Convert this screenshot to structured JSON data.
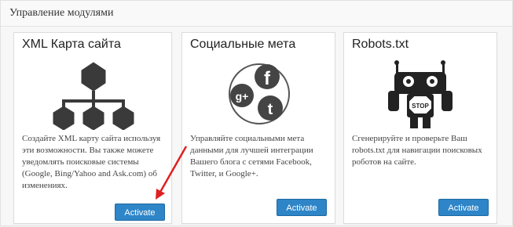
{
  "panel": {
    "title": "Управление модулями"
  },
  "modules": [
    {
      "title": "XML Карта сайта",
      "icon": "sitemap-tree-icon",
      "description": "Создайте XML карту сайта используя эти возможности. Вы также можете уведомлять поисковые системы (Google, Bing/Yahoo and Ask.com) об изменениях.",
      "button": "Activate"
    },
    {
      "title": "Социальные мета",
      "icon": "social-circles-icon",
      "description": "Управляйте социальными мета данными для лучшей интеграции Вашего блога с сетями Facebook, Twitter, и Google+.",
      "button": "Activate"
    },
    {
      "title": "Robots.txt",
      "icon": "robot-stop-icon",
      "description": "Сгенерируйте и проверьте Ваш robots.txt для навигации поисковых роботов на сайте.",
      "button": "Activate"
    }
  ],
  "annotation": {
    "color": "#e02020"
  }
}
